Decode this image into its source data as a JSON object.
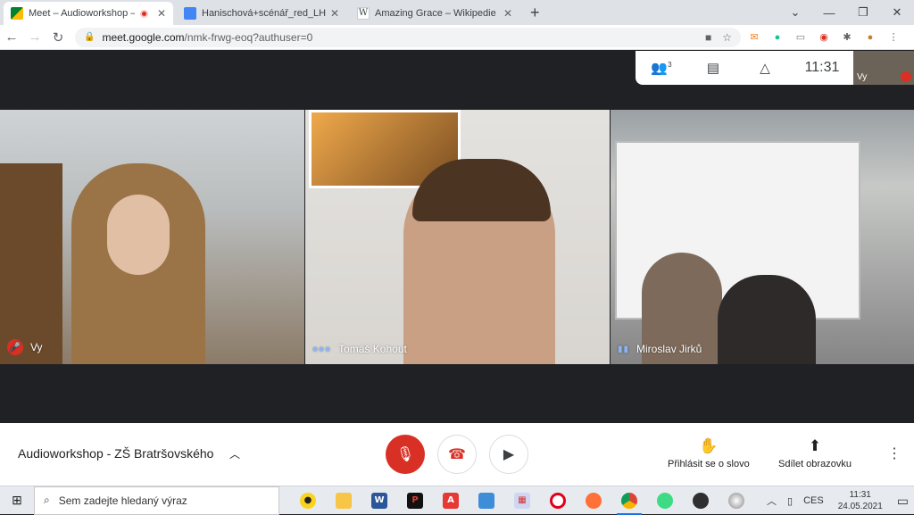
{
  "browser": {
    "tabs": [
      {
        "title": "Meet – Audioworkshop – ZŠ",
        "favicon": "meet-icon",
        "active": true,
        "recording": true
      },
      {
        "title": "Hanischová+scénář_red_LH.docx",
        "favicon": "docs-icon",
        "active": false
      },
      {
        "title": "Amazing Grace – Wikipedie",
        "favicon": "wikipedia-icon",
        "active": false
      }
    ],
    "address": {
      "host": "meet.google.com",
      "path": "/nmk-frwg-eoq?authuser=0"
    }
  },
  "meet": {
    "info_panel": {
      "people_count": "3",
      "time": "11:31"
    },
    "self_thumb_label": "Vy",
    "participants": [
      {
        "name": "Vy",
        "muted": true
      },
      {
        "name": "Tomáš Kohout",
        "muted": false
      },
      {
        "name": "Miroslav Jirků",
        "muted": false
      }
    ],
    "meeting_name": "Audioworkshop - ZŠ Bratršovského",
    "actions": {
      "raise_hand": "Přihlásit se o slovo",
      "present": "Sdílet obrazovku"
    }
  },
  "taskbar": {
    "search_placeholder": "Sem zadejte hledaný výraz",
    "lang": "CES",
    "time": "11:31",
    "date": "24.05.2021"
  },
  "colors": {
    "accent_red": "#d93025",
    "meet_bg": "#202124",
    "blue": "#1a73e8"
  }
}
